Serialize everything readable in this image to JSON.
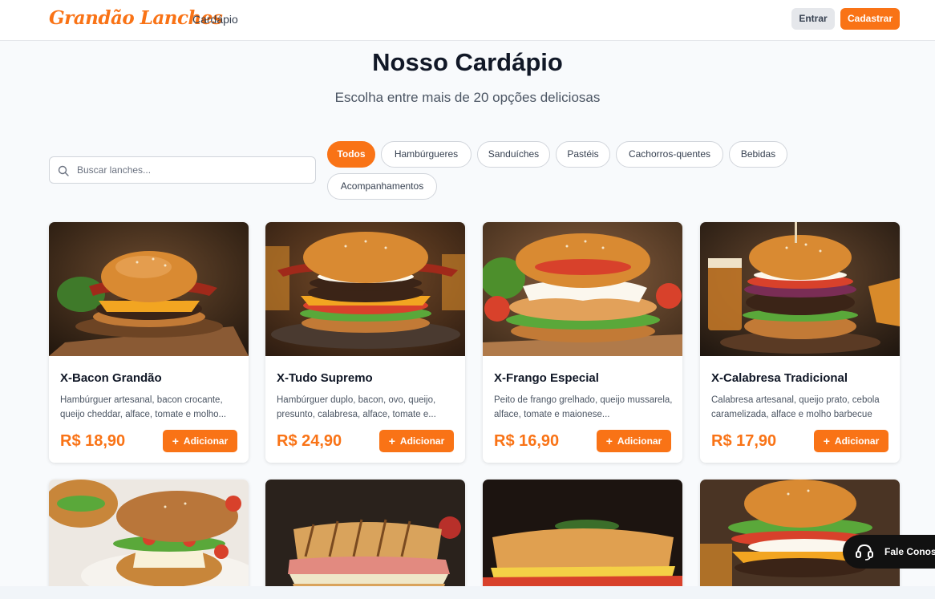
{
  "header": {
    "logo": "Grandão Lanches",
    "nav_menu": "Cardápio",
    "login_label": "Entrar",
    "signup_label": "Cadastrar"
  },
  "hero": {
    "title": "Nosso Cardápio",
    "subtitle": "Escolha entre mais de 20 opções deliciosas"
  },
  "search": {
    "placeholder": "Buscar lanches...",
    "value": ""
  },
  "categories": [
    {
      "label": "Todos",
      "active": true
    },
    {
      "label": "Hambúrgueres",
      "active": false
    },
    {
      "label": "Sanduíches",
      "active": false
    },
    {
      "label": "Pastéis",
      "active": false
    },
    {
      "label": "Cachorros-quentes",
      "active": false
    },
    {
      "label": "Bebidas",
      "active": false
    },
    {
      "label": "Acompanhamentos",
      "active": false
    }
  ],
  "products": [
    {
      "name": "X-Bacon Grandão",
      "description": "Hambúrguer artesanal, bacon crocante, queijo cheddar, alface, tomate e molho...",
      "price": "R$ 18,90",
      "button": "Adicionar"
    },
    {
      "name": "X-Tudo Supremo",
      "description": "Hambúrguer duplo, bacon, ovo, queijo, presunto, calabresa, alface, tomate e...",
      "price": "R$ 24,90",
      "button": "Adicionar"
    },
    {
      "name": "X-Frango Especial",
      "description": "Peito de frango grelhado, queijo mussarela, alface, tomate e maionese...",
      "price": "R$ 16,90",
      "button": "Adicionar"
    },
    {
      "name": "X-Calabresa Tradicional",
      "description": "Calabresa artesanal, queijo prato, cebola caramelizada, alface e molho barbecue",
      "price": "R$ 17,90",
      "button": "Adicionar"
    }
  ],
  "contact": {
    "label": "Fale Conosco",
    "icon": "headset-icon"
  },
  "colors": {
    "accent": "#f97316",
    "text": "#111827",
    "background": "#f8fafc"
  }
}
